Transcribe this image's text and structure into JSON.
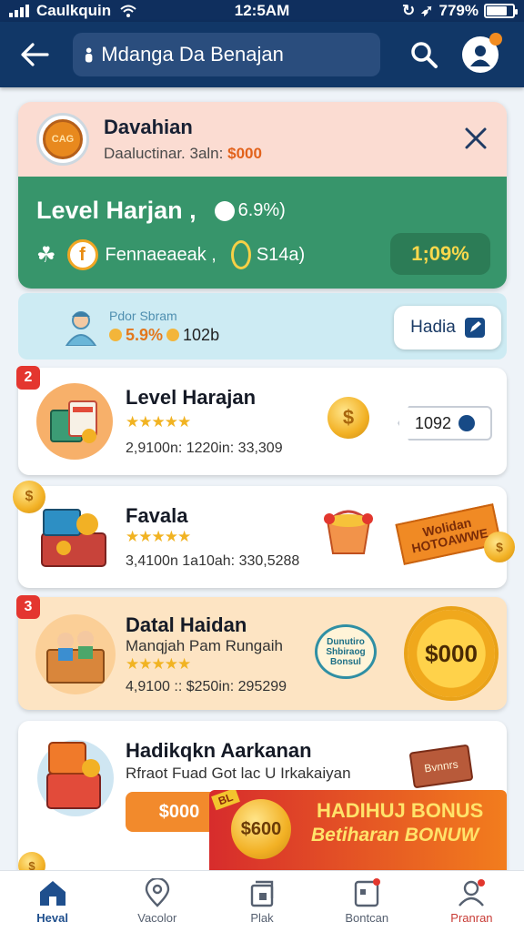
{
  "status_bar": {
    "carrier": "Caulkquin",
    "time": "12:5AM",
    "battery_text": "779%"
  },
  "header": {
    "search_value": "Mdanga Da Benajan"
  },
  "promo": {
    "logo_text": "CAG",
    "title": "Davahian",
    "subtitle_prefix": "Daaluctinar. 3aln:",
    "subtitle_amount": "$000",
    "level_title": "Level Harjan",
    "level_percent": "6.9%)",
    "row_label": "Fennaeaeak",
    "row_value": "S14a)",
    "badge_value": "1;09%"
  },
  "info_strip": {
    "label": "Pdor Sbram",
    "value_a": "5.9%",
    "value_b": "102b",
    "button_label": "Hadia"
  },
  "cards": [
    {
      "rank": "2",
      "title": "Level Harajan",
      "stars": "★★★★★",
      "stats": "2,9100n: 1220in: 33,309",
      "chip_value": "1092"
    },
    {
      "title": "Favala",
      "stars": "★★★★★",
      "stats": "3,4100n 1a10ah: 330,5288",
      "ribbon": "Wolidan HOTOAWWE"
    },
    {
      "rank": "3",
      "title": "Datal Haidan",
      "subtitle": "Manqjah Pam Rungaih",
      "stars": "★★★★★",
      "stats": "4,9100 :: $250in: 295299",
      "badge": "Dunutiro Shbiraog Bonsul",
      "seal": "$000"
    },
    {
      "title": "Hadikqkn Aarkanan",
      "subtitle": "Rfraot Fuad Got lac U Irkakaiyan",
      "cta": "$000",
      "sticker": "Bvnnrs"
    }
  ],
  "bonus_banner": {
    "tag": "BL",
    "coin": "$600",
    "line1": "HADIHUJ BONUS",
    "line2": "Betiharan BONUW"
  },
  "nav": [
    {
      "label": "Heval",
      "icon": "home-icon"
    },
    {
      "label": "Vacolor",
      "icon": "location-pin-icon"
    },
    {
      "label": "Plak",
      "icon": "cards-icon"
    },
    {
      "label": "Bontcan",
      "icon": "tablet-icon"
    },
    {
      "label": "Pranran",
      "icon": "person-icon"
    }
  ],
  "colors": {
    "header": "#113767",
    "promo_green": "#37956b",
    "accent_orange": "#f28a2c",
    "gold": "#f2b125"
  }
}
